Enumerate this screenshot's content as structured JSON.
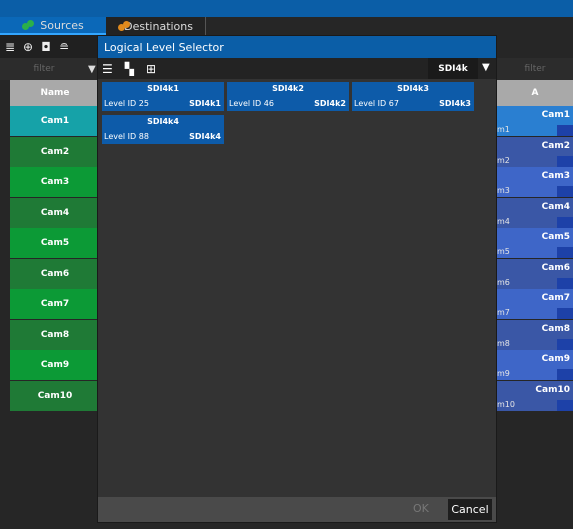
{
  "tabs": [
    {
      "label": "Sources",
      "icon": "sources-icon"
    },
    {
      "label": "Destinations",
      "icon": "destinations-icon"
    }
  ],
  "left": {
    "filter_placeholder": "filter",
    "header": "Name",
    "rows": [
      {
        "label": "Cam1",
        "color": "#16a2a8"
      },
      {
        "label": "Cam2",
        "color": "#1f7a36"
      },
      {
        "label": "Cam3",
        "color": "#0c9a36"
      },
      {
        "label": "Cam4",
        "color": "#1f7a36"
      },
      {
        "label": "Cam5",
        "color": "#0c9a36"
      },
      {
        "label": "Cam6",
        "color": "#1f7a36"
      },
      {
        "label": "Cam7",
        "color": "#0c9a36"
      },
      {
        "label": "Cam8",
        "color": "#1f7a36"
      },
      {
        "label": "Cam9",
        "color": "#0c9a36"
      },
      {
        "label": "Cam10",
        "color": "#1f7a36"
      }
    ]
  },
  "right": {
    "filter_placeholder": "filter",
    "header": "A",
    "rows": [
      {
        "label": "Cam1",
        "sub": "m1",
        "color": "#2a7fd1"
      },
      {
        "label": "Cam2",
        "sub": "m2",
        "color": "#3a57a6"
      },
      {
        "label": "Cam3",
        "sub": "m3",
        "color": "#3e66c8"
      },
      {
        "label": "Cam4",
        "sub": "m4",
        "color": "#3a57a6"
      },
      {
        "label": "Cam5",
        "sub": "m5",
        "color": "#3e66c8"
      },
      {
        "label": "Cam6",
        "sub": "m6",
        "color": "#3a57a6"
      },
      {
        "label": "Cam7",
        "sub": "m7",
        "color": "#3e66c8"
      },
      {
        "label": "Cam8",
        "sub": "m8",
        "color": "#3a57a6"
      },
      {
        "label": "Cam9",
        "sub": "m9",
        "color": "#3e66c8"
      },
      {
        "label": "Cam10",
        "sub": "m10",
        "color": "#3a57a6"
      }
    ]
  },
  "dialog": {
    "title": "Logical Level Selector",
    "level_filter": "SDI4k",
    "levels": [
      {
        "name": "SDI4k1",
        "level_id": "Level ID 25",
        "right": "SDI4k1"
      },
      {
        "name": "SDI4k2",
        "level_id": "Level ID 46",
        "right": "SDI4k2"
      },
      {
        "name": "SDI4k3",
        "level_id": "Level ID 67",
        "right": "SDI4k3"
      },
      {
        "name": "SDI4k4",
        "level_id": "Level ID 88",
        "right": "SDI4k4"
      }
    ],
    "ok_label": "OK",
    "cancel_label": "Cancel"
  }
}
